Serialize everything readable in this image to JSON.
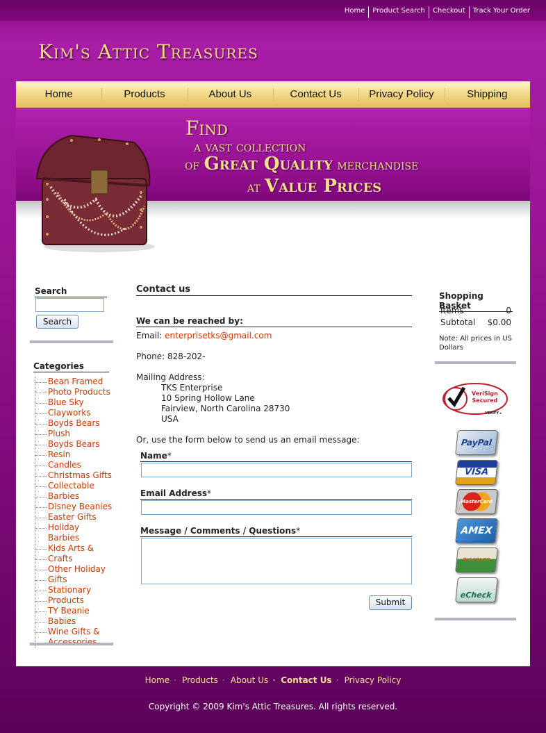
{
  "top_links": [
    "Home",
    "Product Search",
    "Checkout",
    "Track Your Order"
  ],
  "site_title": "Kim's Attic Treasures",
  "nav": [
    "Home",
    "Products",
    "About Us",
    "Contact Us",
    "Privacy Policy",
    "Shipping"
  ],
  "banner": {
    "line1": "Find",
    "line2": "a vast collection",
    "line3a": "of",
    "line3b": "Great Quality",
    "line3c": "merchandise",
    "line4a": "at",
    "line4b": "Value Prices"
  },
  "left": {
    "search_title": "Search",
    "search_value": "",
    "search_button": "Search",
    "categories_title": "Categories",
    "categories": [
      "Bean Framed",
      "Photo Products",
      "Blue Sky",
      "Clayworks",
      "Boyds Bears",
      "Plush",
      "Boyds Bears",
      "Resin",
      "Candles",
      "Christmas Gifts",
      "Collectable",
      "Barbies",
      "Disney Beanies",
      "Easter Gifts",
      "Holiday Barbies",
      "Kids Arts &",
      "Crafts",
      "Other Holiday",
      "Gifts",
      "Stationary",
      "Products",
      "TY Beanie",
      "Babies",
      "Wine Gifts &",
      "Accessories"
    ]
  },
  "center": {
    "title": "Contact us",
    "reached_title": "We can be reached by:",
    "email_label": "Email:",
    "email": "enterprisetks@gmail.com",
    "phone": "Phone: 828-202-",
    "mail_label": "Mailing Address:",
    "address": [
      "TKS Enterprise",
      "10 Spring Hollow Lane",
      "Fairview,  North Carolina  28730",
      "USA"
    ],
    "form_intro": "Or, use the form below to send us an email message:",
    "name_label": "Name",
    "email_field_label": "Email Address",
    "message_label": "Message / Comments / Questions",
    "required_mark": "*",
    "submit": "Submit"
  },
  "right": {
    "basket_title": "Shopping Basket",
    "items_label": "Items",
    "items_value": "0",
    "subtotal_label": "Subtotal",
    "subtotal_value": "$0.00",
    "note": [
      "Note: All prices in US",
      "Dollars"
    ],
    "verisign": [
      "VeriSign",
      "Secured",
      "VERIFY ▸"
    ],
    "cards": [
      "PayPal",
      "VISA",
      "MasterCard",
      "AMEX",
      "DISCOVER NOVUS",
      "eCheck"
    ]
  },
  "footer": {
    "links": [
      "Home",
      "Products",
      "About Us",
      "Contact Us",
      "Privacy Policy"
    ],
    "active": "Contact Us",
    "copyright": "Copyright © 2009 Kim's Attic Treasures. All rights reserved."
  },
  "colors": {
    "accent": "#9c1597",
    "link": "#c73a04",
    "gold": "#f7df8a"
  }
}
